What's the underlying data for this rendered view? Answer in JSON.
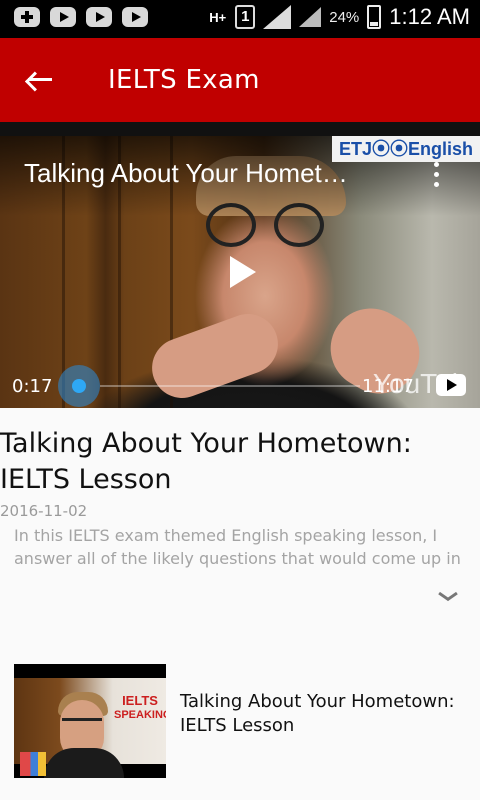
{
  "status_bar": {
    "network": "H+",
    "sim": "1",
    "battery": "24%",
    "time": "1:12 AM"
  },
  "appbar": {
    "title": "IELTS Exam"
  },
  "video": {
    "overlay_title": "Talking About Your Homet…",
    "channel": "ETJ⦿⦿English",
    "watermark": "YouTul",
    "current_time": "0:17",
    "duration": "11:17",
    "progress": 0.026
  },
  "article": {
    "title": "Talking About Your Hometown: IELTS Lesson",
    "date": "2016-11-02",
    "description": "In this IELTS exam themed English speaking lesson, I answer all of the likely questions that would come up in"
  },
  "related": [
    {
      "title": "Talking About Your Hometown: IELTS Lesson",
      "thumb_label_1": "IELTS",
      "thumb_label_2": "SPEAKING"
    }
  ],
  "colors": {
    "appbar": "#c00000",
    "scrubber": "#2ea8f5",
    "channel_text": "#1a4fa8",
    "thumb_label": "#cc1f1f"
  }
}
